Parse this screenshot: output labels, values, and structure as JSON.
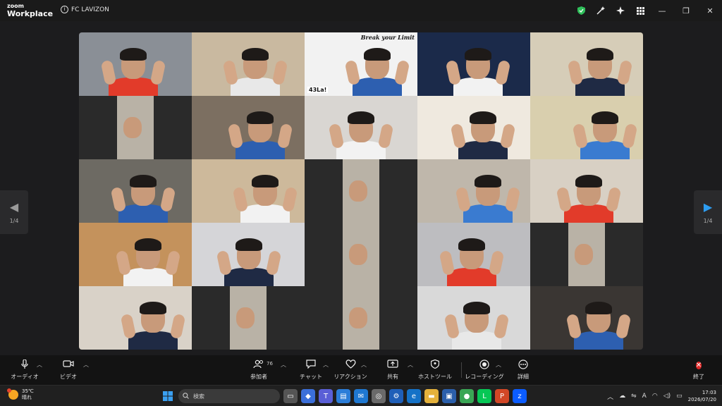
{
  "app": {
    "logo_top": "zoom",
    "logo_bottom": "Workplace",
    "meeting_title": "FC LAVIZON"
  },
  "titlebar_icons": [
    "shield-icon",
    "magic-wand-icon",
    "sparkle-icon",
    "apps-grid-icon"
  ],
  "window_controls": [
    "minimize",
    "restore",
    "close"
  ],
  "nav": {
    "left_page": "1/4",
    "right_page": "1/4"
  },
  "active_tile": {
    "banner": "Break your Limit",
    "badge": "43La!"
  },
  "tile_colors": [
    [
      "#8a8f96",
      "#c9b9a0",
      "#f2f2f2",
      "#1b2a4a",
      "#d6cdb8"
    ],
    [
      "#2a2a2a",
      "#7c6f61",
      "#d9d6d2",
      "#efe9df",
      "#d9cfae"
    ],
    [
      "#6d6a63",
      "#cdb99b",
      "#2a2a2a",
      "#bfb7ab",
      "#d8d0c4"
    ],
    [
      "#c4925c",
      "#d5d5d8",
      "#2a2a2a",
      "#bdbdc0",
      "#2a2a2a"
    ],
    [
      "#d9d2c8",
      "#2a2a2a",
      "#2a2a2a",
      "#d9d9d9",
      "#3a3633"
    ]
  ],
  "toolbar": {
    "audio": "オーディオ",
    "video": "ビデオ",
    "participants": "参加者",
    "participants_count": "76",
    "chat": "チャット",
    "reactions": "リアクション",
    "share": "共有",
    "host_tools": "ホストツール",
    "recording": "レコーディング",
    "details": "詳細",
    "end": "終了"
  },
  "taskbar": {
    "temperature": "35℃",
    "weather": "晴れ",
    "search_placeholder": "検索",
    "time": "17:03",
    "date": "2026/07/20"
  }
}
